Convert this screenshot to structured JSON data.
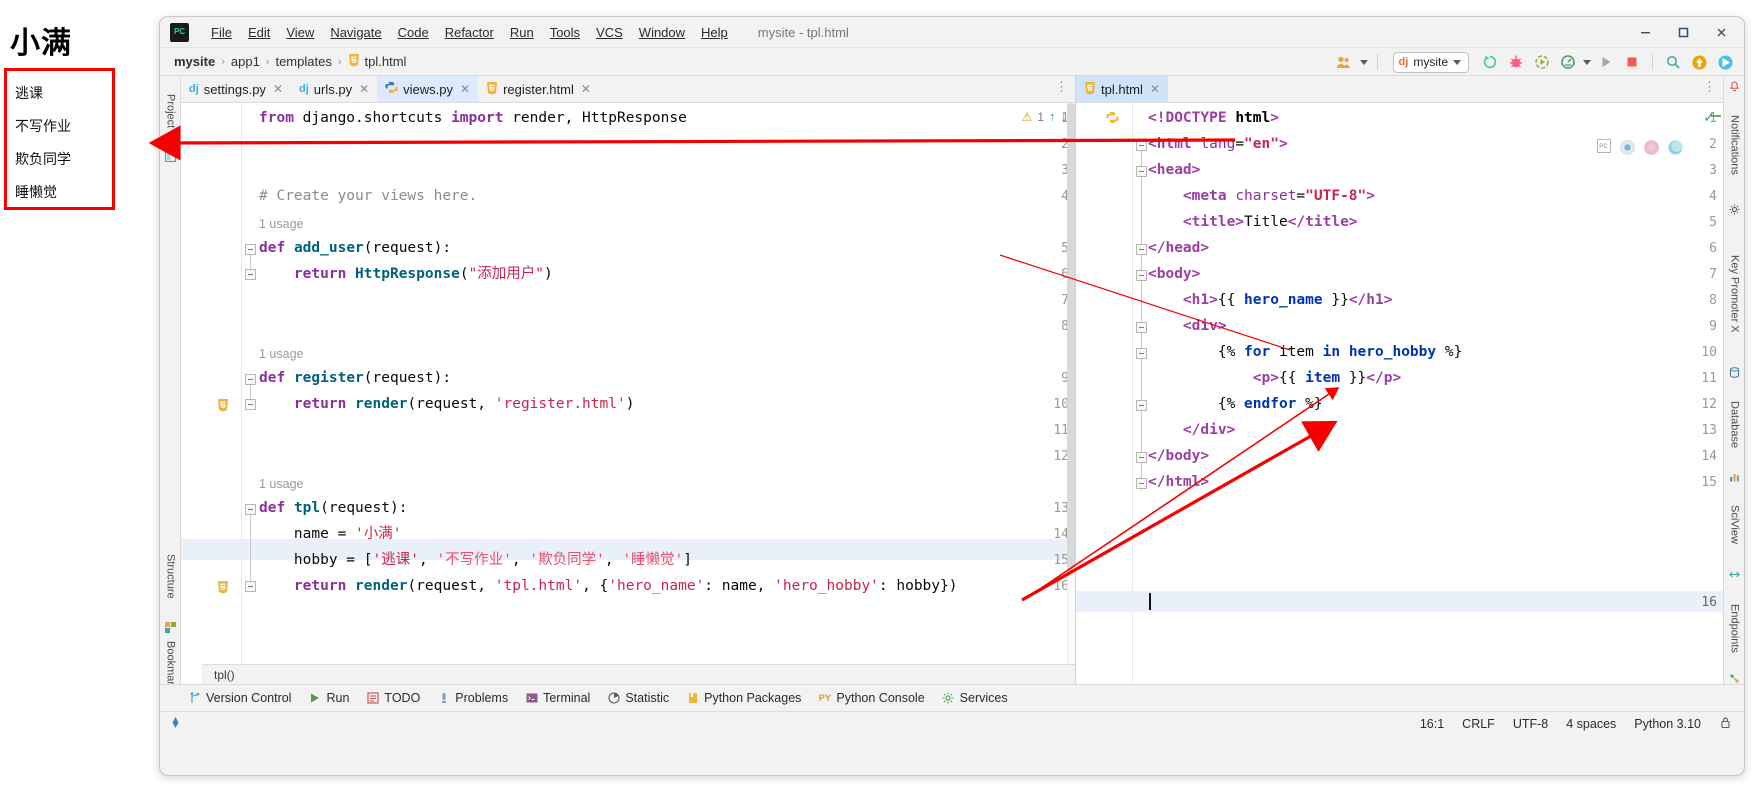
{
  "browser_preview": {
    "heading": "小满",
    "hobby_box_color": "#f40000",
    "hobbies": [
      "逃课",
      "不写作业",
      "欺负同学",
      "睡懒觉"
    ]
  },
  "annotation": {
    "arrow_color": "#f40000"
  },
  "window": {
    "title": "mysite - tpl.html",
    "logo_label": "PC",
    "controls": {
      "minimize": "minimize-icon",
      "maximize": "maximize-icon",
      "close": "close-icon"
    }
  },
  "menu": [
    {
      "label": "File"
    },
    {
      "label": "Edit"
    },
    {
      "label": "View"
    },
    {
      "label": "Navigate"
    },
    {
      "label": "Code"
    },
    {
      "label": "Refactor"
    },
    {
      "label": "Run"
    },
    {
      "label": "Tools"
    },
    {
      "label": "VCS"
    },
    {
      "label": "Window"
    },
    {
      "label": "Help"
    }
  ],
  "breadcrumb": [
    "mysite",
    "app1",
    "templates",
    "tpl.html"
  ],
  "toolbar": {
    "run_config": {
      "prefix": "dj",
      "name": "mysite"
    },
    "icons": [
      "users-icon",
      "rerun-icon",
      "debug-icon",
      "run-coverage-icon",
      "profiler-icon",
      "run-icon",
      "stop-icon",
      "search-icon",
      "update-project-icon",
      "ide-assistant-icon"
    ]
  },
  "left_pane": {
    "tabs": [
      {
        "label": "settings.py",
        "icon": "django-file-icon",
        "active": false
      },
      {
        "label": "urls.py",
        "icon": "django-file-icon",
        "active": false
      },
      {
        "label": "views.py",
        "icon": "python-file-icon",
        "active": true
      },
      {
        "label": "register.html",
        "icon": "html-file-icon",
        "active": false
      }
    ],
    "inspection": {
      "warning_count": "1"
    },
    "code_breadcrumb": "tpl()",
    "highlighted_line": 15,
    "lines": [
      {
        "n": 1,
        "usage": null,
        "text": "from django.shortcuts import render, HttpResponse"
      },
      {
        "n": 2,
        "usage": null,
        "text": ""
      },
      {
        "n": 3,
        "usage": null,
        "text": ""
      },
      {
        "n": 4,
        "usage": null,
        "text": "# Create your views here."
      },
      {
        "n": 5,
        "usage": "1 usage",
        "text": "def add_user(request):"
      },
      {
        "n": 6,
        "usage": null,
        "text": "    return HttpResponse(\"添加用户\")"
      },
      {
        "n": 7,
        "usage": null,
        "text": ""
      },
      {
        "n": 8,
        "usage": null,
        "text": ""
      },
      {
        "n": 9,
        "usage": "1 usage",
        "text": "def register(request):"
      },
      {
        "n": 10,
        "usage": null,
        "text": "    return render(request, 'register.html')"
      },
      {
        "n": 11,
        "usage": null,
        "text": ""
      },
      {
        "n": 12,
        "usage": null,
        "text": ""
      },
      {
        "n": 13,
        "usage": "1 usage",
        "text": "def tpl(request):"
      },
      {
        "n": 14,
        "usage": null,
        "text": "    name = '小满'"
      },
      {
        "n": 15,
        "usage": null,
        "text": "    hobby = ['逃课', '不写作业', '欺负同学', '睡懒觉']"
      },
      {
        "n": 16,
        "usage": null,
        "text": "    return render(request, 'tpl.html', {'hero_name': name, 'hero_hobby': hobby})"
      }
    ]
  },
  "right_pane": {
    "tabs": [
      {
        "label": "tpl.html",
        "icon": "html-file-icon",
        "active": true
      }
    ],
    "caret_line": 16,
    "preview_icons": [
      "pycharm-preview-icon",
      "chrome-icon",
      "firefox-icon",
      "edge-icon"
    ],
    "lines": [
      {
        "n": 1,
        "text": "<!DOCTYPE html>"
      },
      {
        "n": 2,
        "text": "<html lang=\"en\">"
      },
      {
        "n": 3,
        "text": "<head>"
      },
      {
        "n": 4,
        "text": "    <meta charset=\"UTF-8\">"
      },
      {
        "n": 5,
        "text": "    <title>Title</title>"
      },
      {
        "n": 6,
        "text": "</head>"
      },
      {
        "n": 7,
        "text": "<body>"
      },
      {
        "n": 8,
        "text": "    <h1>{{ hero_name }}</h1>"
      },
      {
        "n": 9,
        "text": "    <div>"
      },
      {
        "n": 10,
        "text": "        {% for item in hero_hobby %}"
      },
      {
        "n": 11,
        "text": "            <p>{{ item }}</p>"
      },
      {
        "n": 12,
        "text": "        {% endfor %}"
      },
      {
        "n": 13,
        "text": "    </div>"
      },
      {
        "n": 14,
        "text": "</body>"
      },
      {
        "n": 15,
        "text": "</html>"
      },
      {
        "n": 16,
        "text": ""
      }
    ]
  },
  "bottom_tools": [
    {
      "label": "Version Control",
      "icon": "branch-icon"
    },
    {
      "label": "Run",
      "icon": "run-icon"
    },
    {
      "label": "TODO",
      "icon": "todo-icon"
    },
    {
      "label": "Problems",
      "icon": "problems-icon"
    },
    {
      "label": "Terminal",
      "icon": "terminal-icon"
    },
    {
      "label": "Statistic",
      "icon": "statistic-icon"
    },
    {
      "label": "Python Packages",
      "icon": "packages-icon"
    },
    {
      "label": "Python Console",
      "icon": "python-console-icon"
    },
    {
      "label": "Services",
      "icon": "services-icon"
    }
  ],
  "status_bar": {
    "caret_position": "16:1",
    "line_separator": "CRLF",
    "encoding": "UTF-8",
    "indent": "4 spaces",
    "interpreter": "Python 3.10",
    "left_icon": "ide-event-icon",
    "right_icon": "lock-icon"
  }
}
